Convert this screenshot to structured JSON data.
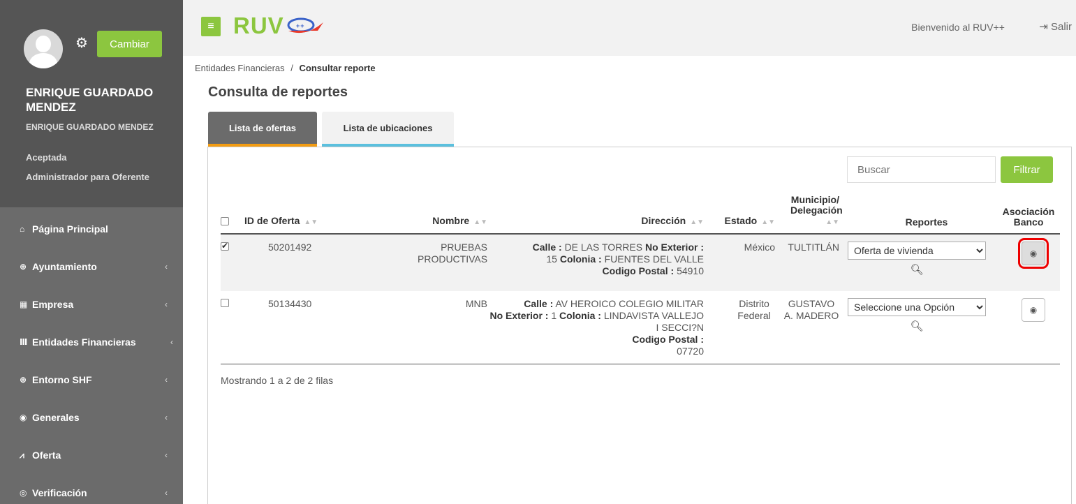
{
  "sidebar": {
    "cambiar_label": "Cambiar",
    "user_name": "ENRIQUE GUARDADO MENDEZ",
    "user_name_small": "ENRIQUE GUARDADO MENDEZ",
    "status": "Aceptada",
    "role": "Administrador para Oferente",
    "items": [
      {
        "label": "Página Principal",
        "icon": "home-icon",
        "glyph": "🏠"
      },
      {
        "label": "Ayuntamiento",
        "icon": "plus-circle-icon",
        "glyph": "⊕"
      },
      {
        "label": "Empresa",
        "icon": "building-icon",
        "glyph": "▦"
      },
      {
        "label": "Entidades Financieras",
        "icon": "bank-icon",
        "glyph": "🏛"
      },
      {
        "label": "Entorno SHF",
        "icon": "plus-circle-icon",
        "glyph": "⊕"
      },
      {
        "label": "Generales",
        "icon": "dashboard-icon",
        "glyph": "◉"
      },
      {
        "label": "Oferta",
        "icon": "line-chart-icon",
        "glyph": "📈"
      },
      {
        "label": "Verificación",
        "icon": "target-icon",
        "glyph": "◎"
      }
    ]
  },
  "topbar": {
    "logo": "RUV",
    "welcome": "Bienvenido al RUV++",
    "logout": "Salir"
  },
  "breadcrumb": {
    "parent": "Entidades Financieras",
    "separator": "/",
    "current": "Consultar reporte"
  },
  "page_title": "Consulta de reportes",
  "tabs": [
    {
      "label": "Lista de ofertas"
    },
    {
      "label": "Lista de ubicaciones"
    }
  ],
  "search": {
    "placeholder": "Buscar"
  },
  "filter_label": "Filtrar",
  "table": {
    "headers": {
      "id": "ID de Oferta",
      "nombre": "Nombre",
      "direccion": "Dirección",
      "estado": "Estado",
      "municipio": "Municipio/ Delegación",
      "reportes": "Reportes",
      "asociacion": "Asociación Banco"
    },
    "rows": [
      {
        "checked": true,
        "id": "50201492",
        "nombre": "PRUEBAS PRODUCTIVAS",
        "calle_label": "Calle :",
        "calle": "DE LAS TORRES",
        "noext_label": "No Exterior :",
        "noext": "15",
        "colonia_label": "Colonia :",
        "colonia": "FUENTES DEL VALLE",
        "cp_label": "Codigo Postal :",
        "cp": "54910",
        "estado": "México",
        "municipio": "TULTITLÁN",
        "reporte": "Oferta de vivienda"
      },
      {
        "checked": false,
        "id": "50134430",
        "nombre": "MNB",
        "calle_label": "Calle :",
        "calle": "AV HEROICO COLEGIO MILITAR",
        "noext_label": "No Exterior :",
        "noext": "1",
        "colonia_label": "Colonia :",
        "colonia": "LINDAVISTA VALLEJO I SECCI?N",
        "cp_label": "Codigo Postal :",
        "cp": "07720",
        "estado": "Distrito Federal",
        "municipio": "GUSTAVO A. MADERO",
        "reporte": "Seleccione una Opción"
      }
    ]
  },
  "footer": {
    "showing": "Mostrando 1 a 2 de 2 filas"
  },
  "colors": {
    "accent_green": "#8cc63f",
    "sidebar_bg": "#6b6b6b",
    "tab_orange": "#f39c12",
    "tab_blue": "#5bc0de",
    "highlight_red": "#e00000"
  }
}
